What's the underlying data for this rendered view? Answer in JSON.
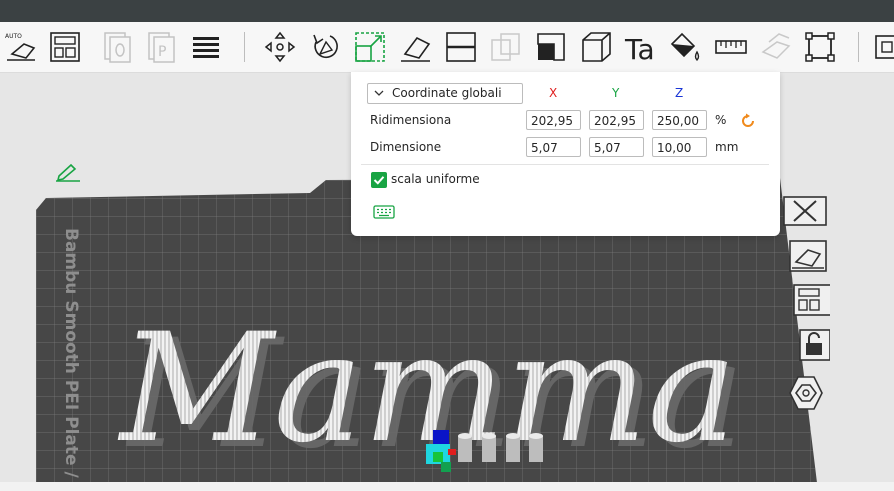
{
  "toolbar": {
    "tools": [
      {
        "name": "auto-orient-icon",
        "label": "AUTO"
      },
      {
        "name": "arrange-icon"
      },
      {
        "name": "disabled-object-icon"
      },
      {
        "name": "disabled-plate-icon",
        "label": "P"
      },
      {
        "name": "layers-icon"
      },
      {
        "name": "move-icon"
      },
      {
        "name": "rotate-icon"
      },
      {
        "name": "scale-icon"
      },
      {
        "name": "place-on-face-icon"
      },
      {
        "name": "cut-icon"
      },
      {
        "name": "boolean-icon"
      },
      {
        "name": "support-paint-icon"
      },
      {
        "name": "seam-paint-icon"
      },
      {
        "name": "text-icon",
        "label": "Ta"
      },
      {
        "name": "color-paint-icon"
      },
      {
        "name": "measure-icon"
      },
      {
        "name": "assembly-icon"
      },
      {
        "name": "split-icon"
      },
      {
        "name": "more-icon"
      }
    ]
  },
  "scale_panel": {
    "coord_mode": "Coordinate globali",
    "axes": {
      "x": "X",
      "y": "Y",
      "z": "Z"
    },
    "axis_colors": {
      "x": "#e01e1e",
      "y": "#18a443",
      "z": "#1a36d6"
    },
    "resize": {
      "label": "Ridimensiona",
      "x": "202,95",
      "y": "202,95",
      "z": "250,00",
      "unit": "%"
    },
    "size": {
      "label": "Dimensione",
      "x": "5,07",
      "y": "5,07",
      "z": "10,00",
      "unit": "mm"
    },
    "uniform": {
      "label": "scala uniforme",
      "checked": true
    },
    "accent": "#18a443",
    "reset_color": "#f08a1c"
  },
  "plate": {
    "label": "Bambu Smooth PEI Plate /",
    "model_text": "Mamma"
  },
  "side_toolbar": {
    "items": [
      "close-icon",
      "auto-orient-plate-icon",
      "arrange-plate-icon",
      "lock-icon",
      "settings-hex-icon"
    ]
  }
}
